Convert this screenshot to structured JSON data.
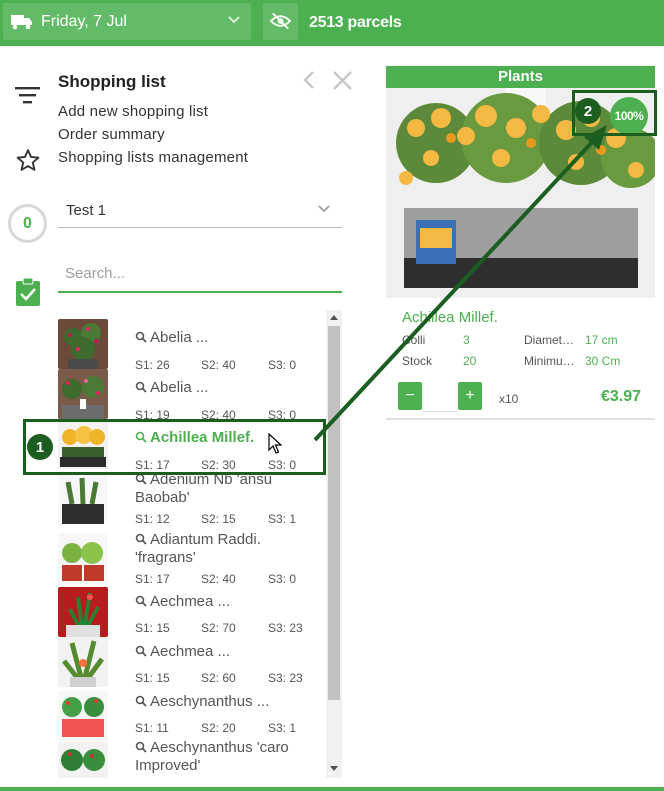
{
  "topbar": {
    "date_label": "Friday, 7 Jul",
    "parcels_label": "2513 parcels",
    "icons": [
      "truck-icon",
      "chevron-down-icon",
      "eye-off-icon"
    ]
  },
  "rail": {
    "counter": "0",
    "icons": [
      "filter-list-icon",
      "star-icon",
      "clipboard-check-icon"
    ]
  },
  "shopping_list": {
    "title": "Shopping list",
    "links": [
      "Add new shopping list",
      "Order summary",
      "Shopping lists management"
    ],
    "selected_list": "Test 1",
    "search_placeholder": "Search...",
    "search_value": ""
  },
  "products": [
    {
      "name": "Abelia ...",
      "s1": "S1: 26",
      "s2": "S2: 40",
      "s3": "S3: 0"
    },
    {
      "name": "Abelia ...",
      "s1": "S1: 19",
      "s2": "S2: 40",
      "s3": "S3: 0"
    },
    {
      "name": "Achillea Millef.",
      "s1": "S1: 17",
      "s2": "S2: 30",
      "s3": "S3: 0"
    },
    {
      "name": "Adenium Nb 'ansu Baobab'",
      "s1": "S1: 12",
      "s2": "S2: 15",
      "s3": "S3: 1"
    },
    {
      "name": "Adiantum Raddi. 'fragrans'",
      "s1": "S1: 17",
      "s2": "S2: 40",
      "s3": "S3: 0"
    },
    {
      "name": "Aechmea ...",
      "s1": "S1: 15",
      "s2": "S2: 70",
      "s3": "S3: 23"
    },
    {
      "name": "Aechmea ...",
      "s1": "S1: 15",
      "s2": "S2: 60",
      "s3": "S3: 23"
    },
    {
      "name": "Aeschynanthus ...",
      "s1": "S1: 11",
      "s2": "S2: 20",
      "s3": "S3: 1"
    },
    {
      "name": "Aeschynanthus 'caro Improved'",
      "s1": "",
      "s2": "",
      "s3": ""
    }
  ],
  "card": {
    "header": "Plants",
    "badge": "100%",
    "name": "Achillea Millef.",
    "specs": {
      "colli_label": "Colli",
      "colli_value": "3",
      "stock_label": "Stock",
      "stock_value": "20",
      "diameter_label": "Diamet…",
      "diameter_value": "17 cm",
      "minimum_label": "Minimu…",
      "minimum_value": "30 Cm"
    },
    "qty_minus": "−",
    "qty_plus": "+",
    "qty_value": "",
    "multiplier": "x10",
    "price": "€3.97"
  },
  "annotations": {
    "step1": "1",
    "step2": "2"
  },
  "colors": {
    "brand_green": "#4caf50",
    "annotation_green": "#1b5e20"
  }
}
